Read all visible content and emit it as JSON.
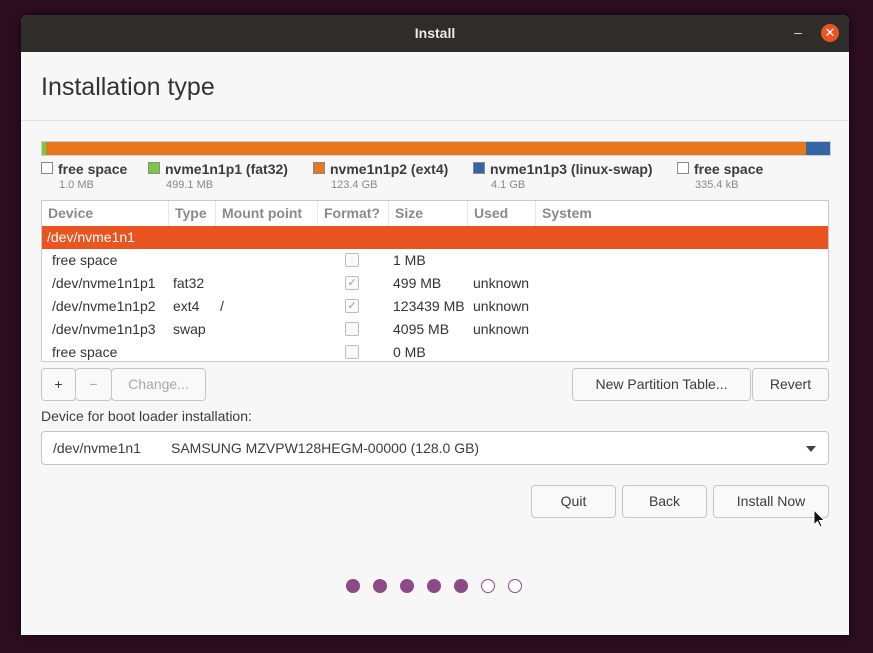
{
  "window": {
    "title": "Install"
  },
  "page": {
    "heading": "Installation type"
  },
  "partition_bar": {
    "segments": [
      {
        "name": "free space",
        "color": "#ffffff",
        "fraction": 0.0005
      },
      {
        "name": "nvme1n1p1 (fat32)",
        "color": "#7ac943",
        "fraction": 0.004
      },
      {
        "name": "nvme1n1p2 (ext4)",
        "color": "#e9771e",
        "fraction": 0.9645
      },
      {
        "name": "nvme1n1p3 (linux-swap)",
        "color": "#3465a4",
        "fraction": 0.031
      }
    ]
  },
  "legend": [
    {
      "name": "free space",
      "size": "1.0 MB",
      "color": "#ffffff"
    },
    {
      "name": "nvme1n1p1 (fat32)",
      "size": "499.1 MB",
      "color": "#7ac943"
    },
    {
      "name": "nvme1n1p2 (ext4)",
      "size": "123.4 GB",
      "color": "#e9771e"
    },
    {
      "name": "nvme1n1p3 (linux-swap)",
      "size": "4.1 GB",
      "color": "#3465a4"
    },
    {
      "name": "free space",
      "size": "335.4 kB",
      "color": "#ffffff"
    }
  ],
  "table": {
    "headers": [
      "Device",
      "Type",
      "Mount point",
      "Format?",
      "Size",
      "Used",
      "System"
    ],
    "rows": [
      {
        "device": "/dev/nvme1n1",
        "type": "",
        "mount": "",
        "format": null,
        "size": "",
        "used": "",
        "system": "",
        "selected": true
      },
      {
        "device": "free space",
        "type": "",
        "mount": "",
        "format": false,
        "size": "1 MB",
        "used": "",
        "system": ""
      },
      {
        "device": "/dev/nvme1n1p1",
        "type": "fat32",
        "mount": "",
        "format": true,
        "size": "499 MB",
        "used": "unknown",
        "system": ""
      },
      {
        "device": "/dev/nvme1n1p2",
        "type": "ext4",
        "mount": "/",
        "format": true,
        "size": "123439 MB",
        "used": "unknown",
        "system": ""
      },
      {
        "device": "/dev/nvme1n1p3",
        "type": "swap",
        "mount": "",
        "format": false,
        "size": "4095 MB",
        "used": "unknown",
        "system": ""
      },
      {
        "device": "free space",
        "type": "",
        "mount": "",
        "format": false,
        "size": "0 MB",
        "used": "",
        "system": ""
      }
    ]
  },
  "buttons": {
    "add": "+",
    "remove": "−",
    "change": "Change...",
    "new_partition_table": "New Partition Table...",
    "revert": "Revert",
    "quit": "Quit",
    "back": "Back",
    "install_now": "Install Now"
  },
  "boot_loader": {
    "label": "Device for boot loader installation:",
    "device": "/dev/nvme1n1",
    "model": "SAMSUNG MZVPW128HEGM-00000 (128.0 GB)"
  },
  "progress": {
    "total_steps": 7,
    "completed_steps": 5,
    "accent": "#8c4a87"
  },
  "colors": {
    "selection": "#e95420",
    "titlebar": "#2f2d2a",
    "desktop": "#2c0c1f"
  }
}
